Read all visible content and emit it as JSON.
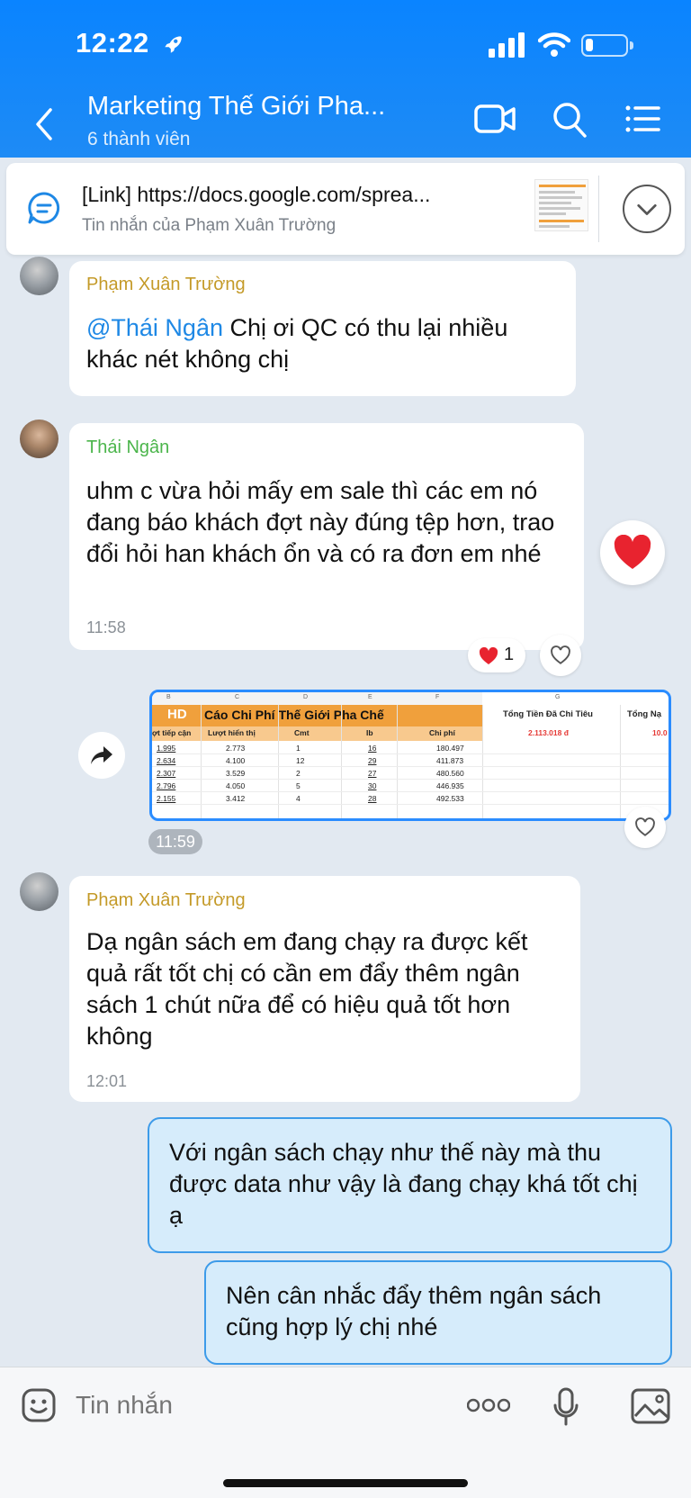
{
  "status_bar": {
    "time": "12:22"
  },
  "header": {
    "title": "Marketing Thế Giới Pha...",
    "subtitle": "6 thành viên",
    "icons": [
      "back-icon",
      "video-call-icon",
      "search-icon",
      "menu-list-icon"
    ],
    "color": "#0a84ff"
  },
  "pinned": {
    "title": "[Link] https://docs.google.com/sprea...",
    "subtitle": "Tin nhắn của Phạm Xuân Trường"
  },
  "messages": {
    "m1": {
      "sender": "Phạm Xuân Trường",
      "mention": "@Thái Ngân",
      "text": " Chị ơi QC có thu lại nhiều khác nét không chị"
    },
    "m2": {
      "sender": "Thái Ngân",
      "text": "uhm c vừa hỏi mấy em sale thì các em nó đang báo khách đợt này đúng tệp hơn, trao đổi hỏi han khách ổn và có ra đơn em nhé",
      "time": "11:58",
      "reaction_count": "1"
    },
    "m3": {
      "time": "11:59",
      "sheet": {
        "badge": "HD",
        "col_letters": [
          "B",
          "C",
          "D",
          "E",
          "F",
          "G"
        ],
        "title": "Cáo Chi Phí Thế Giới Pha Chế",
        "headers": [
          "ợt tiếp cận",
          "Lượt hiển thị",
          "Cmt",
          "Ib",
          "Chi phí"
        ],
        "rows": [
          [
            "1.995",
            "2.773",
            "1",
            "16",
            "180.497"
          ],
          [
            "2.634",
            "4.100",
            "12",
            "29",
            "411.873"
          ],
          [
            "2.307",
            "3.529",
            "2",
            "27",
            "480.560"
          ],
          [
            "2.796",
            "4.050",
            "5",
            "30",
            "446.935"
          ],
          [
            "2.155",
            "3.412",
            "4",
            "28",
            "492.533"
          ]
        ],
        "total_label": "Tổng Tiền Đã Chi Tiêu",
        "total_value": "2.113.018 đ",
        "extra_label": "Tổng Nạ",
        "extra_value": "10.0"
      }
    },
    "m4": {
      "sender": "Phạm Xuân Trường",
      "text": "Dạ ngân sách em đang chạy ra được kết quả rất tốt chị có cần em đẩy thêm ngân sách 1 chút nữa để có hiệu quả tốt hơn không",
      "time": "12:01"
    },
    "m5": {
      "text": "Với ngân sách chạy như thế này mà thu được data như vậy là đang chạy khá tốt chị ạ"
    },
    "m6": {
      "text": "Nên cân nhắc đẩy thêm ngân sách cũng hợp lý chị nhé"
    }
  },
  "composer": {
    "placeholder": "Tin nhắn",
    "icons": [
      "emoji-icon",
      "more-dots-icon",
      "microphone-icon",
      "image-icon"
    ]
  }
}
